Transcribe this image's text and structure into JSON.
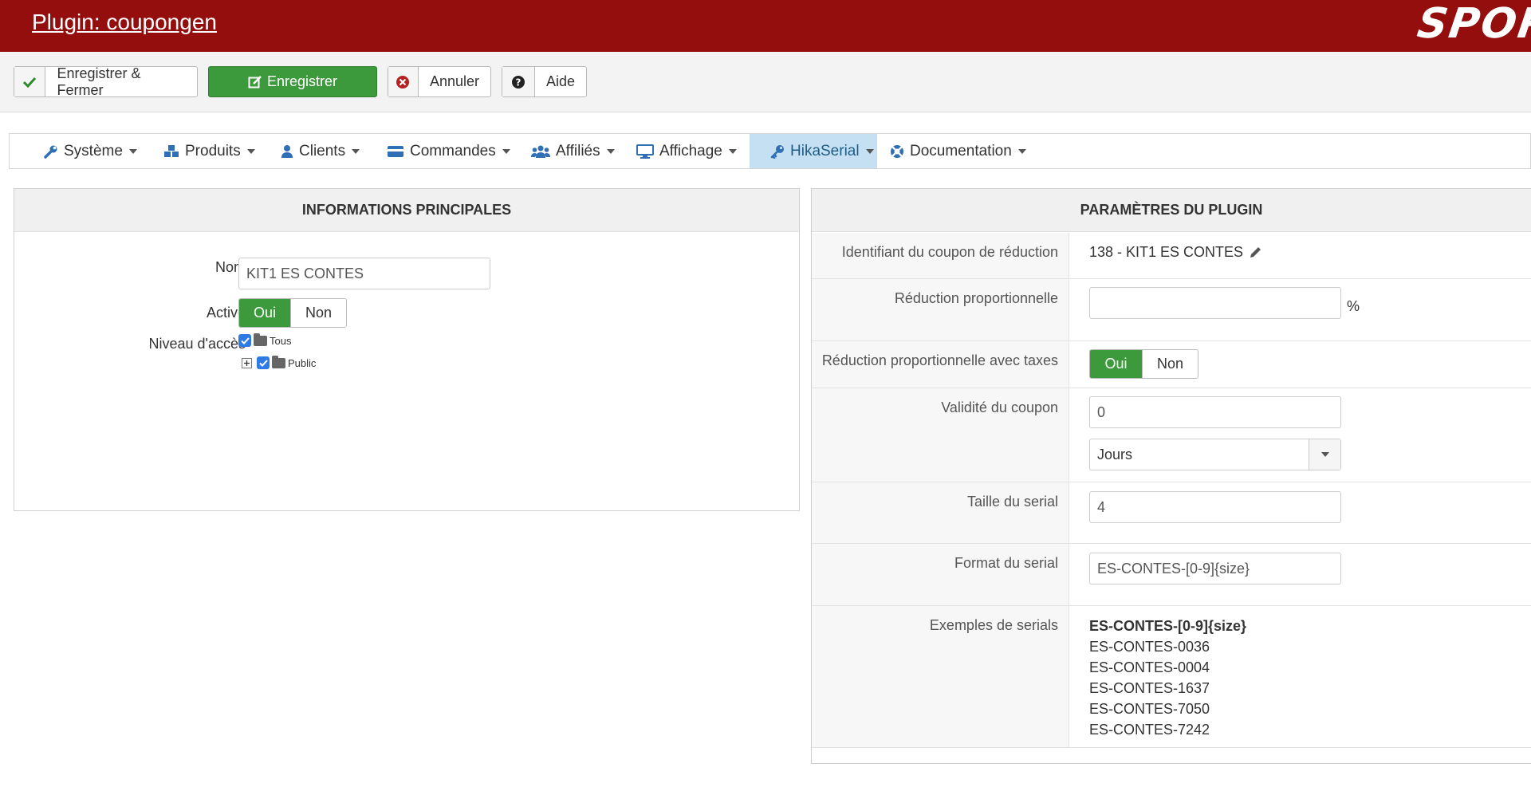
{
  "header": {
    "title": "Plugin: coupongen",
    "logo_text": "SPORT"
  },
  "toolbar": {
    "save_close_label": "Enregistrer & Fermer",
    "save_label": "Enregistrer",
    "cancel_label": "Annuler",
    "help_label": "Aide"
  },
  "menu": {
    "items": [
      {
        "label": "Système",
        "icon": "wrench-icon"
      },
      {
        "label": "Produits",
        "icon": "cubes-icon"
      },
      {
        "label": "Clients",
        "icon": "user-icon"
      },
      {
        "label": "Commandes",
        "icon": "credit-card-icon"
      },
      {
        "label": "Affiliés",
        "icon": "users-icon"
      },
      {
        "label": "Affichage",
        "icon": "monitor-icon"
      },
      {
        "label": "HikaSerial",
        "icon": "key-icon"
      },
      {
        "label": "Documentation",
        "icon": "lifebuoy-icon"
      }
    ],
    "active": "HikaSerial",
    "active_color": "#c5dff3"
  },
  "left": {
    "heading": "INFORMATIONS PRINCIPALES",
    "name_label": "Nom",
    "name_value": "KIT1 ES CONTES",
    "active_label": "Activé",
    "yes": "Oui",
    "no": "Non",
    "access_label": "Niveau d'accès",
    "tree": [
      "Tous",
      "Public"
    ]
  },
  "right": {
    "heading": "PARAMÈTRES DU PLUGIN",
    "coupon_label": "Identifiant du coupon de réduction",
    "coupon_value": "138 - KIT1 ES CONTES",
    "percent_label": "Réduction proportionnelle",
    "percent_value": "",
    "percent_unit": "%",
    "tax_label": "Réduction proportionnelle avec taxes",
    "yes": "Oui",
    "no": "Non",
    "validity_label": "Validité du coupon",
    "validity_value": "0",
    "validity_unit": "Jours",
    "size_label": "Taille du serial",
    "size_value": "4",
    "format_label": "Format du serial",
    "format_value": "ES-CONTES-[0-9]{size}",
    "examples_label": "Exemples de serials",
    "examples_title": "ES-CONTES-[0-9]{size}",
    "examples": [
      "ES-CONTES-0036",
      "ES-CONTES-0004",
      "ES-CONTES-1637",
      "ES-CONTES-7050",
      "ES-CONTES-7242"
    ]
  },
  "colors": {
    "header_bg": "#950e0e",
    "green": "#3c9a3c"
  }
}
